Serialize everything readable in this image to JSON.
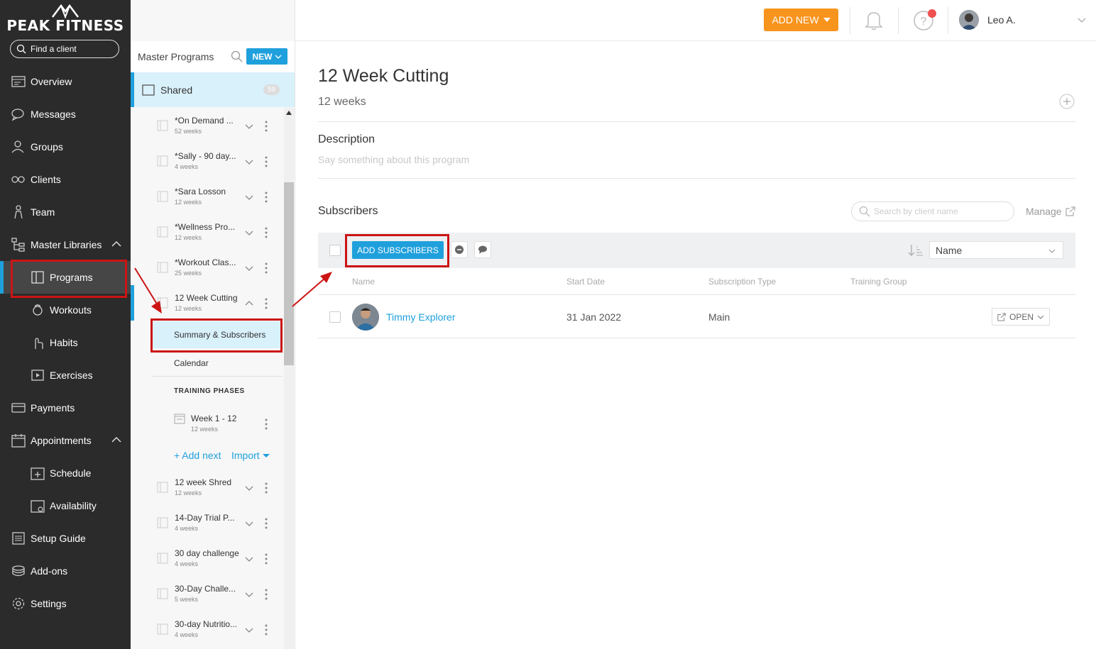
{
  "brand": {
    "name": "PEAK FITNESS"
  },
  "find_client": {
    "placeholder": "Find a client"
  },
  "nav": {
    "items": [
      {
        "label": "Overview",
        "icon": "overview-icon"
      },
      {
        "label": "Messages",
        "icon": "messages-icon"
      },
      {
        "label": "Groups",
        "icon": "groups-icon"
      },
      {
        "label": "Clients",
        "icon": "clients-icon"
      },
      {
        "label": "Team",
        "icon": "team-icon"
      },
      {
        "label": "Master Libraries",
        "icon": "libraries-icon"
      },
      {
        "label": "Programs",
        "icon": "programs-icon"
      },
      {
        "label": "Workouts",
        "icon": "workouts-icon"
      },
      {
        "label": "Habits",
        "icon": "habits-icon"
      },
      {
        "label": "Exercises",
        "icon": "exercises-icon"
      },
      {
        "label": "Payments",
        "icon": "payments-icon"
      },
      {
        "label": "Appointments",
        "icon": "appointments-icon"
      },
      {
        "label": "Schedule",
        "icon": "schedule-icon"
      },
      {
        "label": "Availability",
        "icon": "availability-icon"
      },
      {
        "label": "Setup Guide",
        "icon": "setup-guide-icon"
      },
      {
        "label": "Add-ons",
        "icon": "add-ons-icon"
      },
      {
        "label": "Settings",
        "icon": "settings-icon"
      }
    ]
  },
  "master_programs": {
    "title": "Master Programs",
    "new_label": "NEW",
    "folder": {
      "label": "Shared",
      "count": "59"
    },
    "programs": [
      {
        "title": "*On Demand ...",
        "weeks": "52 weeks"
      },
      {
        "title": "*Sally - 90 day...",
        "weeks": "4 weeks"
      },
      {
        "title": "*Sara Losson",
        "weeks": "12 weeks"
      },
      {
        "title": "*Wellness Pro...",
        "weeks": "12 weeks"
      },
      {
        "title": "*Workout Clas...",
        "weeks": "25 weeks"
      },
      {
        "title": "12 Week Cutting",
        "weeks": "12 weeks"
      },
      {
        "title": "12 week Shred",
        "weeks": "12 weeks"
      },
      {
        "title": "14-Day Trial P...",
        "weeks": "4 weeks"
      },
      {
        "title": "30 day challenge",
        "weeks": "4 weeks"
      },
      {
        "title": "30-Day Challe...",
        "weeks": "5 weeks"
      },
      {
        "title": "30-day Nutritio...",
        "weeks": "4 weeks"
      }
    ],
    "submenu": {
      "summary": "Summary & Subscribers",
      "calendar": "Calendar"
    },
    "phases_label": "TRAINING PHASES",
    "phase": {
      "title": "Week 1 - 12",
      "weeks": "12 weeks"
    },
    "add_next": "+ Add next",
    "import": "Import"
  },
  "topbar": {
    "add_new": "ADD NEW",
    "user_name": "Leo A."
  },
  "program": {
    "title": "12 Week Cutting",
    "duration": "12 weeks",
    "description_label": "Description",
    "description_placeholder": "Say something about this program"
  },
  "subscribers": {
    "label": "Subscribers",
    "search_placeholder": "Search by client name",
    "manage_label": "Manage",
    "add_button": "ADD SUBSCRIBERS",
    "sort_value": "Name",
    "columns": [
      "Name",
      "Start Date",
      "Subscription Type",
      "Training Group"
    ],
    "rows": [
      {
        "name": "Timmy Explorer",
        "start_date": "31 Jan 2022",
        "type": "Main",
        "group": "",
        "action": "OPEN"
      }
    ]
  },
  "colors": {
    "accent": "#1fa0dc",
    "orange": "#f7941d",
    "sidebar": "#2b2b2b",
    "highlight": "#cc1414"
  }
}
